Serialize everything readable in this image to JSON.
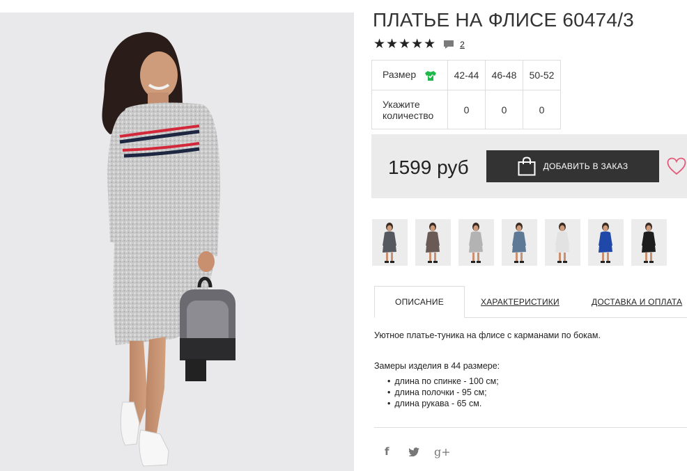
{
  "product": {
    "title": "ПЛАТЬЕ НА ФЛИСЕ 60474/3",
    "rating_stars": "★★★★★",
    "rating_value": 5,
    "review_count": "2",
    "icons": {
      "comment": "speech-bubble-icon",
      "size_chart": "t-shirt-icon",
      "cart": "shopping-bag-icon",
      "wishlist": "heart-icon",
      "accent_green": "#1fb84b",
      "heart_color": "#e45a7a"
    }
  },
  "sizes": {
    "size_label": "Размер",
    "quantity_label": "Укажите количество",
    "columns": [
      "42-44",
      "46-48",
      "50-52"
    ],
    "quantities": [
      "0",
      "0",
      "0"
    ]
  },
  "purchase": {
    "price": "1599 руб",
    "add_button": "ДОБАВИТЬ В ЗАКАЗ"
  },
  "thumbnails": [
    {
      "color": "#55585e"
    },
    {
      "color": "#6a5a55"
    },
    {
      "color": "#b3b3b3"
    },
    {
      "color": "#5e7995"
    },
    {
      "color": "#e2e2e2"
    },
    {
      "color": "#1f48a8"
    },
    {
      "color": "#1d1d1d"
    }
  ],
  "tabs": {
    "description": "ОПИСАНИЕ",
    "characteristics": "ХАРАКТЕРИСТИКИ",
    "delivery": "ДОСТАВКА И ОПЛАТА"
  },
  "description": {
    "text": "Уютное платье-туника на флисе с карманами по бокам.",
    "measurements_title": "Замеры изделия в 44 размере:",
    "measurements": [
      "длина по спинке - 100 см;",
      "длина полочки - 95 см;",
      "длина рукава - 65 см."
    ]
  },
  "social": {
    "facebook": "f",
    "twitter": "🐦",
    "googleplus": "g+"
  }
}
